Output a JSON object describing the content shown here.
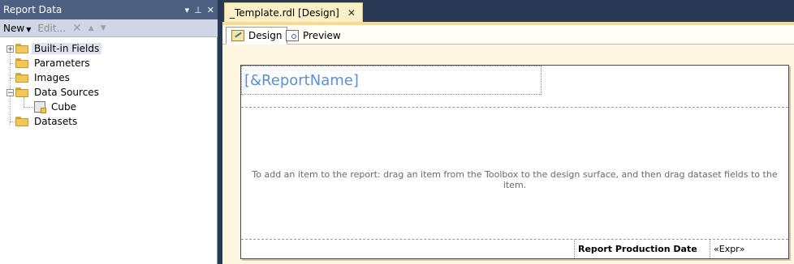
{
  "report_data_panel": {
    "title": "Report Data",
    "title_icons": [
      "dropdown-arrow-icon",
      "pin-icon",
      "close-icon"
    ],
    "toolbar": {
      "new_label": "New",
      "edit_label": "Edit...",
      "delete_icon": "delete-x-icon",
      "move_up_icon": "move-up-icon",
      "move_down_icon": "move-down-icon"
    },
    "tree": [
      {
        "label": "Built-in Fields",
        "expander": "+",
        "icon": "folder-icon"
      },
      {
        "label": "Parameters",
        "icon": "folder-icon"
      },
      {
        "label": "Images",
        "icon": "folder-icon"
      },
      {
        "label": "Data Sources",
        "expander": "−",
        "icon": "open-folder-icon"
      },
      {
        "label": "Cube",
        "icon": "data-source-icon"
      },
      {
        "label": "Datasets",
        "icon": "folder-icon"
      }
    ]
  },
  "document": {
    "tab_title": "_Template.rdl [Design]",
    "tab_close": "✕",
    "view_tabs": {
      "design_label": "Design",
      "preview_label": "Preview"
    }
  },
  "report": {
    "header_textbox": "[&ReportName]",
    "body_message": "To add an item to the report: drag an item from the Toolbox to the design surface, and then drag dataset fields to the item.",
    "footer_label": "Report Production Date",
    "footer_expr": "«Expr»"
  },
  "colors": {
    "panel_title_bg": "#4d6082",
    "app_background": "#293955",
    "active_doc_tab": "#fbf0c6",
    "report_name_text": "#5b8fcf"
  }
}
